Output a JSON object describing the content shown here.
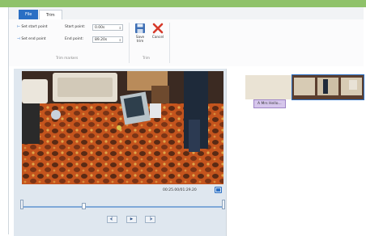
{
  "tabs": {
    "file": "File",
    "trim": "Trim"
  },
  "ribbon": {
    "set_start_point": "Set start point",
    "set_end_point": "Set end point",
    "start_point_label": "Start point:",
    "end_point_label": "End point:",
    "start_point_value": "0.00s",
    "end_point_value": "89.20s",
    "group_trim_markers": "Trim markers",
    "save_trim": "Save trim",
    "cancel": "Cancel",
    "group_trim": "Trim"
  },
  "player": {
    "timecode": "00:25.00/01:29.20",
    "progress": 0.31
  },
  "storyboard": {
    "caption": "Mrs Hello..."
  },
  "colors": {
    "accent": "#2a6fc4",
    "cancel": "#d63a2b",
    "caption": "#d6c6ec"
  }
}
